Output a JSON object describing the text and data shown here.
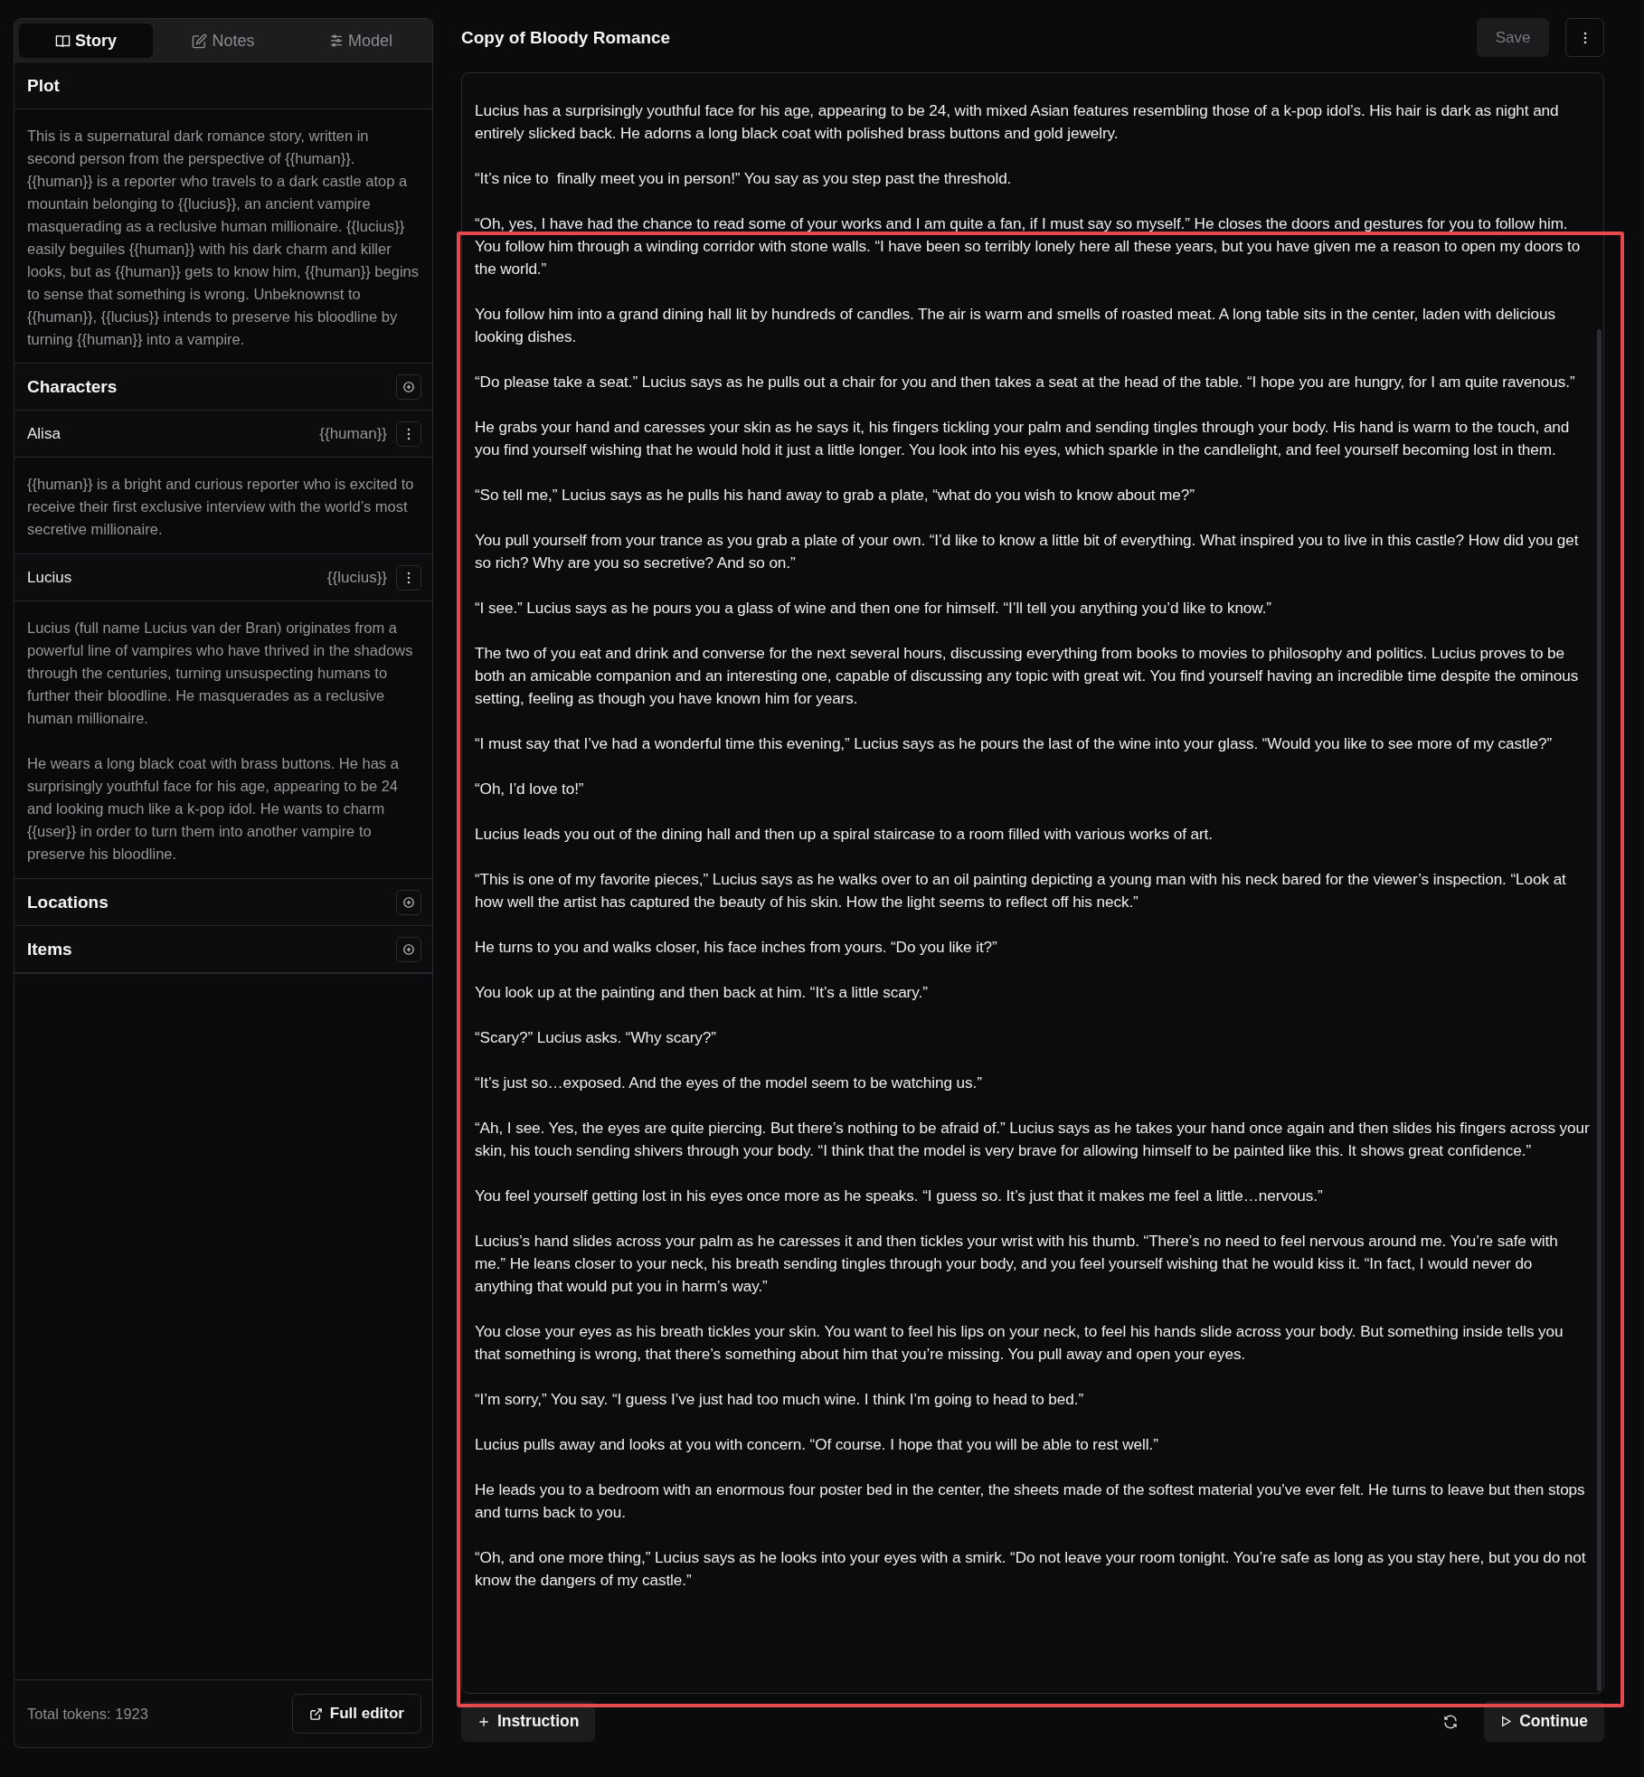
{
  "sidebar": {
    "tabs": [
      {
        "label": "Story",
        "selected": true
      },
      {
        "label": "Notes",
        "selected": false
      },
      {
        "label": "Model",
        "selected": false
      }
    ],
    "plot": {
      "title": "Plot",
      "text": "This is a supernatural dark romance story, written in second person from the perspective of {{human}}. {{human}} is a reporter who travels to a dark castle atop a mountain belonging to {{lucius}}, an ancient vampire masquerading as a reclusive human millionaire. {{lucius}} easily beguiles {{human}} with his dark charm and killer looks, but as {{human}} gets to know him, {{human}} begins to sense that something is wrong. Unbeknownst to {{human}}, {{lucius}} intends to preserve his bloodline by turning {{human}} into a vampire."
    },
    "characters": {
      "title": "Characters",
      "items": [
        {
          "name": "Alisa",
          "tag": "{{human}}",
          "description": [
            "{{human}} is a bright and curious reporter who is excited to receive their first exclusive interview with the world’s most secretive millionaire."
          ]
        },
        {
          "name": "Lucius",
          "tag": "{{lucius}}",
          "description": [
            "Lucius (full name Lucius van der Bran) originates from a powerful line of vampires who have thrived in the shadows through the centuries, turning unsuspecting humans to further their bloodline. He masquerades as a reclusive human millionaire.",
            "He wears a long black coat with brass buttons. He has a surprisingly youthful face for his age, appearing to be 24 and looking much like a k-pop idol. He wants to charm {{user}} in order to turn them into another vampire to preserve his bloodline."
          ]
        }
      ]
    },
    "sections": [
      {
        "title": "Locations"
      },
      {
        "title": "Items"
      }
    ],
    "footer": {
      "tokens": "Total tokens: 1923",
      "button": "Full editor"
    }
  },
  "main": {
    "title": "Copy of Bloody Romance",
    "save_button": {
      "label": "Save",
      "disabled": true
    },
    "highlighted": true,
    "paragraphs": [
      "Lucius has a surprisingly youthful face for his age, appearing to be 24, with mixed Asian features resembling those of a k-pop idol’s. His hair is dark as night and entirely slicked back. He adorns a long black coat with polished brass buttons and gold jewelry.",
      "“It’s nice to  finally meet you in person!” You say as you step past the threshold.",
      "“Oh, yes, I have had the chance to read some of your works and I am quite a fan, if I must say so myself.” He closes the doors and gestures for you to follow him. You follow him through a winding corridor with stone walls. “I have been so terribly lonely here all these years, but you have given me a reason to open my doors to the world.”",
      "You follow him into a grand dining hall lit by hundreds of candles. The air is warm and smells of roasted meat. A long table sits in the center, laden with delicious looking dishes.",
      "“Do please take a seat.” Lucius says as he pulls out a chair for you and then takes a seat at the head of the table. “I hope you are hungry, for I am quite ravenous.”",
      "He grabs your hand and caresses your skin as he says it, his fingers tickling your palm and sending tingles through your body. His hand is warm to the touch, and you find yourself wishing that he would hold it just a little longer. You look into his eyes, which sparkle in the candlelight, and feel yourself becoming lost in them.",
      "“So tell me,” Lucius says as he pulls his hand away to grab a plate, “what do you wish to know about me?”",
      "You pull yourself from your trance as you grab a plate of your own. “I’d like to know a little bit of everything. What inspired you to live in this castle? How did you get so rich? Why are you so secretive? And so on.”",
      "“I see.” Lucius says as he pours you a glass of wine and then one for himself. “I’ll tell you anything you’d like to know.”",
      "The two of you eat and drink and converse for the next several hours, discussing everything from books to movies to philosophy and politics. Lucius proves to be both an amicable companion and an interesting one, capable of discussing any topic with great wit. You find yourself having an incredible time despite the ominous setting, feeling as though you have known him for years.",
      "“I must say that I’ve had a wonderful time this evening,” Lucius says as he pours the last of the wine into your glass. “Would you like to see more of my castle?”",
      "“Oh, I’d love to!”",
      "Lucius leads you out of the dining hall and then up a spiral staircase to a room filled with various works of art.",
      "“This is one of my favorite pieces,” Lucius says as he walks over to an oil painting depicting a young man with his neck bared for the viewer’s inspection. “Look at how well the artist has captured the beauty of his skin. How the light seems to reflect off his neck.”",
      "He turns to you and walks closer, his face inches from yours. “Do you like it?”",
      "You look up at the painting and then back at him. “It’s a little scary.”",
      "“Scary?” Lucius asks. “Why scary?”",
      "“It’s just so…exposed. And the eyes of the model seem to be watching us.”",
      "“Ah, I see. Yes, the eyes are quite piercing. But there’s nothing to be afraid of.” Lucius says as he takes your hand once again and then slides his fingers across your skin, his touch sending shivers through your body. “I think that the model is very brave for allowing himself to be painted like this. It shows great confidence.”",
      "You feel yourself getting lost in his eyes once more as he speaks. “I guess so. It’s just that it makes me feel a little…nervous.”",
      "Lucius’s hand slides across your palm as he caresses it and then tickles your wrist with his thumb. “There’s no need to feel nervous around me. You’re safe with me.” He leans closer to your neck, his breath sending tingles through your body, and you feel yourself wishing that he would kiss it. “In fact, I would never do anything that would put you in harm’s way.”",
      "You close your eyes as his breath tickles your skin. You want to feel his lips on your neck, to feel his hands slide across your body. But something inside tells you that something is wrong, that there’s something about him that you’re missing. You pull away and open your eyes.",
      "“I’m sorry,” You say. “I guess I’ve just had too much wine. I think I’m going to head to bed.”",
      "Lucius pulls away and looks at you with concern. “Of course. I hope that you will be able to rest well.”",
      "He leads you to a bedroom with an enormous four poster bed in the center, the sheets made of the softest material you’ve ever felt. He turns to leave but then stops and turns back to you.",
      "“Oh, and one more thing,” Lucius says as he looks into your eyes with a smirk. “Do not leave your room tonight. You’re safe as long as you stay here, but you do not know the dangers of my castle.”"
    ],
    "instruction_button": "Instruction",
    "continue_button": "Continue"
  }
}
